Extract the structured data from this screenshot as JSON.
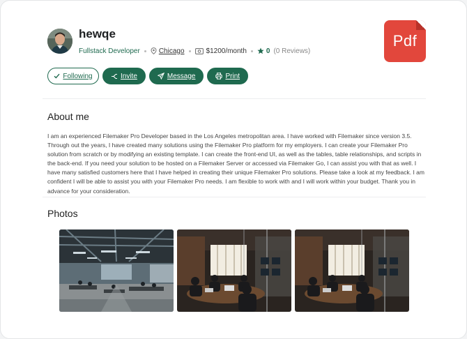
{
  "profile": {
    "name": "hewqe",
    "role": "Fullstack Developer",
    "location": "Chicago",
    "rate": "$1200/month",
    "rating": "0",
    "reviews": "(0 Reviews)"
  },
  "pdf_badge": "Pdf",
  "actions": {
    "following": "Following",
    "invite": "Invite",
    "message": "Message",
    "print": "Print"
  },
  "about": {
    "heading": "About me",
    "text": "I am an experienced Filemaker Pro Developer based in the Los Angeles metropolitan area. I have worked with Filemaker since version 3.5. Through out the years, I have created many solutions using the Filemaker Pro platform for my employers. I can create your Filemaker Pro solution from scratch or by modifying an existing template. I can create the front-end UI, as well as the tables, table relationships, and scripts in the back-end. If you need your solution to be hosted on a Filemaker Server or accessed via Filemaker Go, I can assist you with that as well. I have many satisfied customers here that I have helped in creating their unique Filemaker Pro solutions. Please take a look at my feedback. I am confident I will be able to assist you with your Filemaker Pro needs. I am flexible to work with and I will work within your budget. Thank you in advance for your consideration."
  },
  "photos": {
    "heading": "Photos",
    "items": [
      "open-office-photo",
      "meeting-room-photo",
      "meeting-room-photo"
    ]
  },
  "colors": {
    "accent": "#1f6a4f",
    "pdf": "#e2473c"
  }
}
